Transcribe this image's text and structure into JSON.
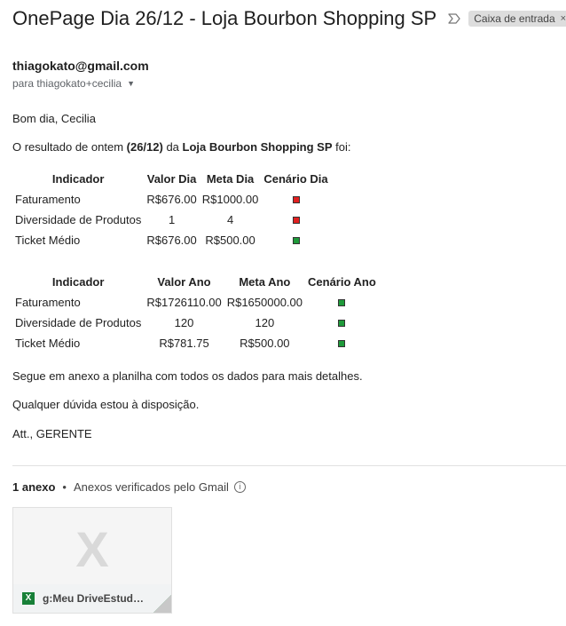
{
  "email": {
    "subject": "OnePage Dia 26/12 - Loja Bourbon Shopping SP",
    "label": "Caixa de entrada",
    "label_close": "×",
    "sender": "thiagokato@gmail.com",
    "recipient": "para thiagokato+cecilia",
    "greeting": "Bom dia, Cecilia",
    "intro": {
      "pre": "O resultado de ontem ",
      "date": "(26/12)",
      "mid": " da ",
      "store": "Loja Bourbon Shopping SP",
      "post": " foi:"
    },
    "table_day": {
      "headers": [
        "Indicador",
        "Valor Dia",
        "Meta Dia",
        "Cenário Dia"
      ],
      "rows": [
        {
          "name": "Faturamento",
          "value": "R$676.00",
          "target": "R$1000.00",
          "status": "red"
        },
        {
          "name": "Diversidade de Produtos",
          "value": "1",
          "target": "4",
          "status": "red"
        },
        {
          "name": "Ticket Médio",
          "value": "R$676.00",
          "target": "R$500.00",
          "status": "green"
        }
      ]
    },
    "table_year": {
      "headers": [
        "Indicador",
        "Valor Ano",
        "Meta Ano",
        "Cenário Ano"
      ],
      "rows": [
        {
          "name": "Faturamento",
          "value": "R$1726110.00",
          "target": "R$1650000.00",
          "status": "green"
        },
        {
          "name": "Diversidade de Produtos",
          "value": "120",
          "target": "120",
          "status": "green"
        },
        {
          "name": "Ticket Médio",
          "value": "R$781.75",
          "target": "R$500.00",
          "status": "green"
        }
      ]
    },
    "attachment_note": "Segue em anexo a planilha com todos os dados para mais detalhes.",
    "closing_help": "Qualquer dúvida estou à disposição.",
    "signature": "Att., GERENTE"
  },
  "attachments": {
    "count_label": "1 anexo",
    "separator": "•",
    "verified_label": "Anexos verificados pelo Gmail",
    "info_glyph": "i",
    "file": {
      "thumb_letter": "X",
      "type_letter": "X",
      "name": "g:Meu DriveEstud…",
      "icon": "excel-icon"
    }
  },
  "colors": {
    "status_red": "#e02020",
    "status_green": "#1e9a3a",
    "excel_green": "#188038"
  }
}
